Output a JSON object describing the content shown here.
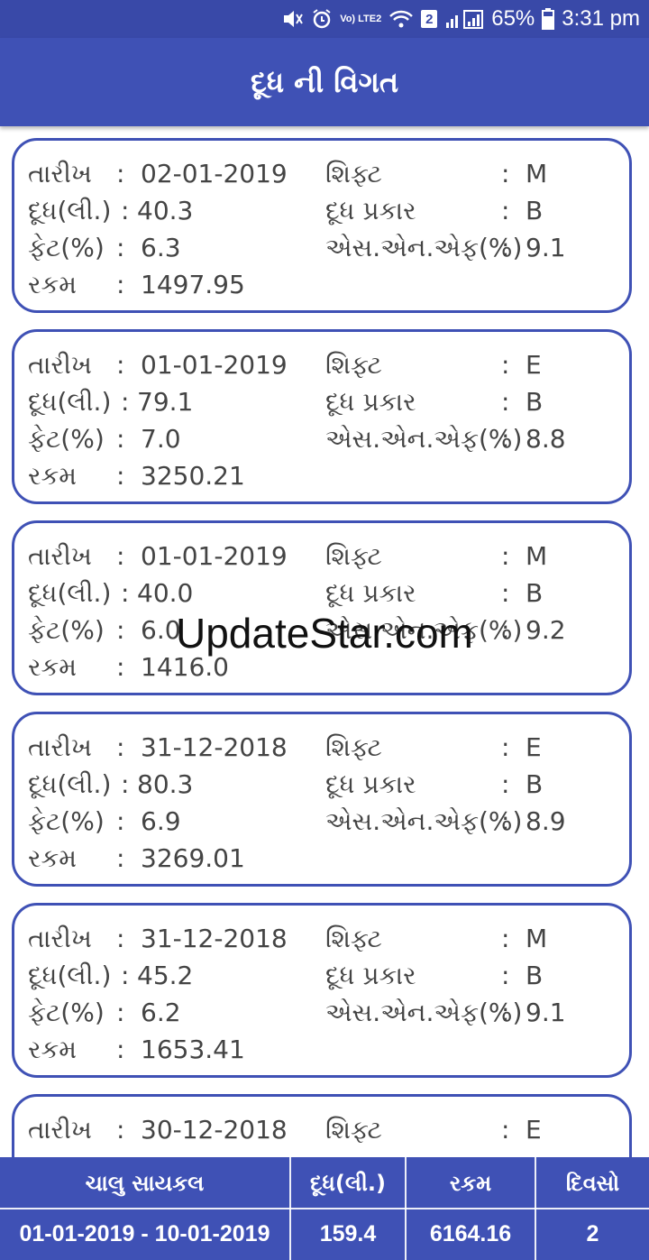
{
  "status_bar": {
    "battery": "65%",
    "time": "3:31 pm",
    "network": "Vo) LTE2",
    "sim": "2",
    "icons": [
      "mute-icon",
      "alarm-icon",
      "lte-icon",
      "wifi-icon",
      "sim-icon",
      "signal-icon",
      "battery-icon"
    ]
  },
  "header": {
    "title": "દૂધ ની વિગત"
  },
  "labels": {
    "date": "તારીખ",
    "milk": "દૂધ(લી.)",
    "fat": "ફેટ(%)",
    "amount": "રકમ",
    "shift": "શિફ્ટ",
    "milk_type": "દૂધ પ્રકાર",
    "snf": "એસ.એન.એફ(%)",
    "colon": ":"
  },
  "records": [
    {
      "date": "02-01-2019",
      "milk": "40.3",
      "fat": "6.3",
      "amount": "1497.95",
      "shift": "M",
      "milk_type": "B",
      "snf": "9.1"
    },
    {
      "date": "01-01-2019",
      "milk": "79.1",
      "fat": "7.0",
      "amount": "3250.21",
      "shift": "E",
      "milk_type": "B",
      "snf": "8.8"
    },
    {
      "date": "01-01-2019",
      "milk": "40.0",
      "fat": "6.0",
      "amount": "1416.0",
      "shift": "M",
      "milk_type": "B",
      "snf": "9.2"
    },
    {
      "date": "31-12-2018",
      "milk": "80.3",
      "fat": "6.9",
      "amount": "3269.01",
      "shift": "E",
      "milk_type": "B",
      "snf": "8.9"
    },
    {
      "date": "31-12-2018",
      "milk": "45.2",
      "fat": "6.2",
      "amount": "1653.41",
      "shift": "M",
      "milk_type": "B",
      "snf": "9.1"
    },
    {
      "date": "30-12-2018",
      "milk": "",
      "fat": "",
      "amount": "",
      "shift": "E",
      "milk_type": "",
      "snf": ""
    }
  ],
  "watermark": "UpdateStar.com",
  "summary": {
    "headers": [
      "ચાલુ સાયકલ",
      "દૂધ(લી.)",
      "રકમ",
      "દિવસો"
    ],
    "values": [
      "01-01-2019 - 10-01-2019",
      "159.4",
      "6164.16",
      "2"
    ]
  },
  "colors": {
    "primary": "#3f51b5",
    "status_bar": "#3949a8",
    "text": "#444444"
  }
}
